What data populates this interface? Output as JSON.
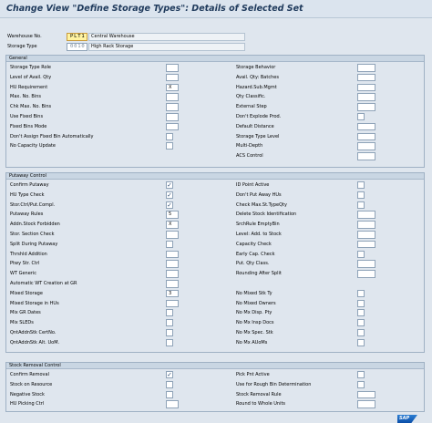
{
  "title": "Change View \"Define Storage Types\": Details of Selected Set",
  "header": {
    "warehouse_label": "Warehouse No.",
    "warehouse_value": "PLT1",
    "warehouse_desc": "Central Warehouse",
    "storage_type_label": "Storage Type",
    "storage_type_value": "0010",
    "storage_type_desc": "High Rack Storage"
  },
  "groups": {
    "general": {
      "title": "General",
      "left": [
        {
          "label": "Storage Type Role",
          "kind": "input",
          "value": ""
        },
        {
          "label": "Level of Avail. Qty",
          "kind": "input",
          "value": ""
        },
        {
          "label": "HU Requirement",
          "kind": "input",
          "value": "X"
        },
        {
          "label": "Max. No. Bins",
          "kind": "input",
          "value": ""
        },
        {
          "label": "Chk Max. No. Bins",
          "kind": "input",
          "value": ""
        },
        {
          "label": "Use Fixed Bins",
          "kind": "input",
          "value": ""
        },
        {
          "label": "Fixed Bins Mode",
          "kind": "input",
          "value": ""
        },
        {
          "label": "Don't Assign Fixed Bin Automatically",
          "kind": "checkbox",
          "value": ""
        },
        {
          "label": "No Capacity Update",
          "kind": "checkbox",
          "value": ""
        }
      ],
      "right": [
        {
          "label": "Storage Behavior",
          "kind": "input",
          "value": ""
        },
        {
          "label": "Avail. Qty: Batches",
          "kind": "input",
          "value": ""
        },
        {
          "label": "Hazard.Sub.Mgmt",
          "kind": "input",
          "value": ""
        },
        {
          "label": "Qty Classific.",
          "kind": "input",
          "value": ""
        },
        {
          "label": "External Step",
          "kind": "input",
          "value": ""
        },
        {
          "label": "Don't Explode Prod.",
          "kind": "checkbox",
          "value": ""
        },
        {
          "label": "Default Distance",
          "kind": "input",
          "value": ""
        },
        {
          "label": "Storage Type Level",
          "kind": "input",
          "value": ""
        },
        {
          "label": "Multi-Depth",
          "kind": "input",
          "value": ""
        },
        {
          "label": "ACS Control",
          "kind": "input",
          "value": ""
        }
      ]
    },
    "putaway": {
      "title": "Putaway Control",
      "left": [
        {
          "label": "Confirm Putaway",
          "kind": "checkbox",
          "value": "✓"
        },
        {
          "label": "HU Type Check",
          "kind": "checkbox",
          "value": "✓"
        },
        {
          "label": "Stor.Ctrl/Put.Compl.",
          "kind": "checkbox",
          "value": "✓"
        },
        {
          "label": "Putaway Rules",
          "kind": "input",
          "value": "5"
        },
        {
          "label": "Addn.Stock Forbidden",
          "kind": "input",
          "value": "X"
        },
        {
          "label": "Stor. Section Check",
          "kind": "input",
          "value": ""
        },
        {
          "label": "Split During Putaway",
          "kind": "checkbox",
          "value": ""
        },
        {
          "label": "Thrshld Addition",
          "kind": "input",
          "value": ""
        },
        {
          "label": "Ptwy Str. Ctrl",
          "kind": "input",
          "value": ""
        },
        {
          "label": "WT Generic",
          "kind": "input",
          "value": ""
        },
        {
          "label": "Automatic WT Creation at GR",
          "kind": "input",
          "value": ""
        },
        {
          "label": "Mixed Storage",
          "kind": "input",
          "value": "3"
        },
        {
          "label": "Mixed Storage in HUs",
          "kind": "input",
          "value": ""
        },
        {
          "label": "Mix GR Dates",
          "kind": "checkbox",
          "value": ""
        },
        {
          "label": "Mix SLEDs",
          "kind": "checkbox",
          "value": ""
        },
        {
          "label": "QntAddnStk CertNo.",
          "kind": "checkbox",
          "value": ""
        },
        {
          "label": "QntAddnStk Alt. UoM.",
          "kind": "checkbox",
          "value": ""
        }
      ],
      "right": [
        {
          "label": "ID Point Active",
          "kind": "checkbox",
          "value": ""
        },
        {
          "label": "Don't Put Away HUs",
          "kind": "checkbox",
          "value": ""
        },
        {
          "label": "Check Max.St.TypeQty",
          "kind": "checkbox",
          "value": ""
        },
        {
          "label": "Delete Stock Identification",
          "kind": "input",
          "value": ""
        },
        {
          "label": "SrchRule EmptyBin",
          "kind": "input",
          "value": ""
        },
        {
          "label": "Level: Add. to Stock",
          "kind": "input",
          "value": ""
        },
        {
          "label": "Capacity Check",
          "kind": "input",
          "value": ""
        },
        {
          "label": "Early Cap. Check",
          "kind": "checkbox",
          "value": ""
        },
        {
          "label": "Put. Qty Class.",
          "kind": "input",
          "value": ""
        },
        {
          "label": "Rounding After Split",
          "kind": "input",
          "value": ""
        },
        {
          "label": "",
          "kind": "none",
          "value": ""
        },
        {
          "label": "No Mixed Stk Ty",
          "kind": "checkbox",
          "value": ""
        },
        {
          "label": "No Mixed Owners",
          "kind": "checkbox",
          "value": ""
        },
        {
          "label": "No Mx Disp. Pty",
          "kind": "checkbox",
          "value": ""
        },
        {
          "label": "No Mx Insp Docs",
          "kind": "checkbox",
          "value": ""
        },
        {
          "label": "No Mx Spec. Stk",
          "kind": "checkbox",
          "value": ""
        },
        {
          "label": "No Mx AUoMs",
          "kind": "checkbox",
          "value": ""
        }
      ]
    },
    "removal": {
      "title": "Stock Removal Control",
      "left": [
        {
          "label": "Confirm Removal",
          "kind": "checkbox",
          "value": "✓"
        },
        {
          "label": "Stock on Resource",
          "kind": "checkbox",
          "value": ""
        },
        {
          "label": "Negative Stock",
          "kind": "checkbox",
          "value": ""
        },
        {
          "label": "HU Picking Ctrl",
          "kind": "input",
          "value": ""
        }
      ],
      "right": [
        {
          "label": "Pick Pnt Active",
          "kind": "checkbox",
          "value": ""
        },
        {
          "label": "Use for Rough Bin Determination",
          "kind": "checkbox",
          "value": ""
        },
        {
          "label": "Stock Removal Rule",
          "kind": "input",
          "value": ""
        },
        {
          "label": "Round to Whole Units",
          "kind": "input",
          "value": ""
        }
      ]
    }
  },
  "brand": "SAP"
}
